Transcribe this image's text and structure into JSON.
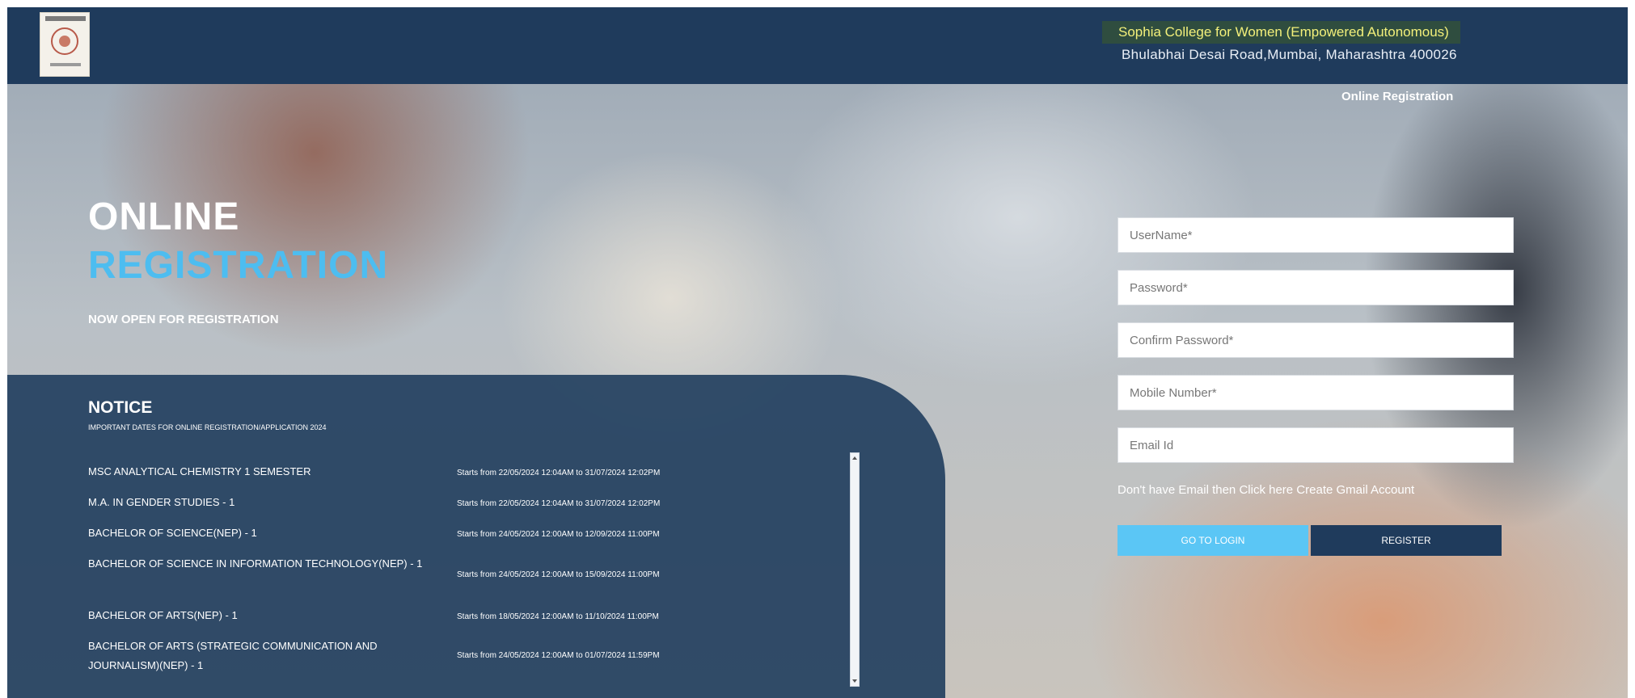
{
  "header": {
    "college_name": "Sophia College for Women (Empowered Autonomous)",
    "address": "Bhulabhai Desai Road,Mumbai, Maharashtra 400026"
  },
  "nav": {
    "online_registration": "Online Registration"
  },
  "hero": {
    "line1": "ONLINE",
    "line2": "REGISTRATION",
    "subtitle": "NOW OPEN FOR REGISTRATION"
  },
  "notice": {
    "title": "NOTICE",
    "subtitle": "IMPORTANT DATES FOR ONLINE REGISTRATION/APPLICATION 2024",
    "items": [
      {
        "course": "MSC ANALYTICAL CHEMISTRY 1 SEMESTER",
        "dates": "Starts from 22/05/2024 12:04AM to 31/07/2024 12:02PM"
      },
      {
        "course": "M.A. IN GENDER STUDIES - 1",
        "dates": "Starts from 22/05/2024 12:04AM to 31/07/2024 12:02PM"
      },
      {
        "course": "BACHELOR OF SCIENCE(NEP) - 1",
        "dates": "Starts from 24/05/2024 12:00AM to 12/09/2024 11:00PM"
      },
      {
        "course": "BACHELOR OF SCIENCE IN INFORMATION TECHNOLOGY(NEP) - 1",
        "dates": "Starts from 24/05/2024 12:00AM to 15/09/2024 11:00PM"
      },
      {
        "course": "BACHELOR OF ARTS(NEP) - 1",
        "dates": "Starts from 18/05/2024 12:00AM to 11/10/2024 11:00PM"
      },
      {
        "course": "BACHELOR OF ARTS (STRATEGIC COMMUNICATION AND JOURNALISM)(NEP) - 1",
        "dates": "Starts from 24/05/2024 12:00AM to 01/07/2024 11:59PM"
      }
    ]
  },
  "form": {
    "username_placeholder": "UserName*",
    "password_placeholder": "Password*",
    "confirm_password_placeholder": "Confirm Password*",
    "mobile_placeholder": "Mobile Number*",
    "email_placeholder": "Email Id",
    "gmail_link": "Don't have Email then Click here Create Gmail Account",
    "login_button": "GO TO LOGIN",
    "register_button": "REGISTER"
  },
  "colors": {
    "header_bg": "#1f3b5c",
    "accent_blue": "#4dbdf0",
    "login_button": "#5bc6f5",
    "register_button": "#1f3b5c",
    "college_name_text": "#f3f07a"
  }
}
